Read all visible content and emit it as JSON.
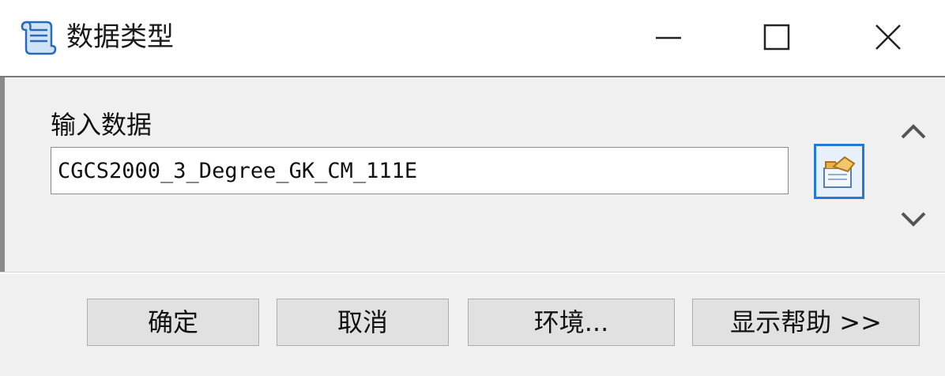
{
  "window": {
    "title": "数据类型",
    "icon": "script-tool-icon"
  },
  "title_controls": {
    "minimize_icon": "minimize-icon",
    "maximize_icon": "maximize-icon",
    "close_icon": "close-icon"
  },
  "form": {
    "input_label": "输入数据",
    "input_value": "CGCS2000_3_Degree_GK_CM_111E",
    "browse_icon": "open-folder-icon"
  },
  "buttons": {
    "ok": "确定",
    "cancel": "取消",
    "environment": "环境...",
    "show_help": "显示帮助 >>"
  },
  "colors": {
    "focus_border": "#1f7ad9",
    "window_bg": "#f0f0f0"
  }
}
